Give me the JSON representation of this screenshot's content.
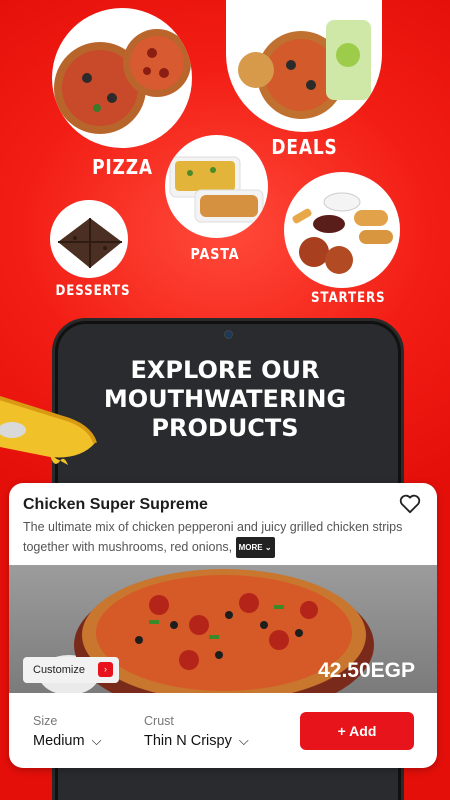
{
  "categories": [
    {
      "id": "pizza",
      "label": "PIZZA"
    },
    {
      "id": "deals",
      "label": "DEALS"
    },
    {
      "id": "pasta",
      "label": "PASTA"
    },
    {
      "id": "desserts",
      "label": "DESSERTS"
    },
    {
      "id": "starters",
      "label": "STARTERS"
    }
  ],
  "promo": {
    "headline_lines": [
      "EXPLORE OUR",
      "MOUTHWATERING",
      "PRODUCTS"
    ]
  },
  "product": {
    "name": "Chicken Super Supreme",
    "description": "The ultimate mix of chicken pepperoni and juicy grilled chicken strips together with mushrooms, red onions,",
    "more_label": "MORE",
    "customize_label": "Customize",
    "price": "42.50EGP",
    "size": {
      "label": "Size",
      "value": "Medium"
    },
    "crust": {
      "label": "Crust",
      "value": "Thin N Crispy"
    },
    "add_label": "+ Add"
  },
  "colors": {
    "brand_red": "#e8141c",
    "background_red": "#f21d14"
  }
}
